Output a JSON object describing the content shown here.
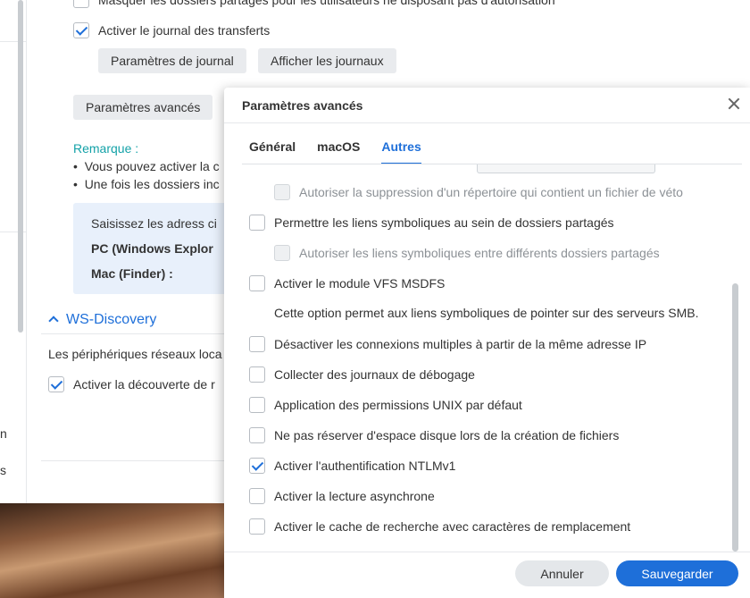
{
  "background": {
    "left_fragments": [
      "n",
      "s"
    ],
    "hide_shared_folders_label": "Masquer les dossiers partagés pour les utilisateurs ne disposant pas d'autorisation",
    "enable_transfer_log_label": "Activer le journal des transferts",
    "log_settings_button": "Paramètres de journal",
    "show_logs_button": "Afficher les journaux",
    "advanced_settings_button": "Paramètres avancés",
    "note_title": "Remarque :",
    "note_bullets": [
      "Vous pouvez activer la c",
      "Une fois les dossiers inc"
    ],
    "info_box": {
      "line1": "Saisissez les adress ci",
      "pc_label": "PC (Windows Explor",
      "mac_label": "Mac (Finder) :"
    },
    "ws_discovery": {
      "title": "WS-Discovery",
      "description": "Les périphériques réseaux loca",
      "enable_label": "Activer la découverte de r"
    }
  },
  "dialog": {
    "title": "Paramètres avancés",
    "tabs": [
      {
        "label": "Général",
        "active": false
      },
      {
        "label": "macOS",
        "active": false
      },
      {
        "label": "Autres",
        "active": true
      }
    ],
    "options": [
      {
        "label": "Autoriser la suppression d'un répertoire qui contient un fichier de véto",
        "checked": false,
        "disabled": true
      },
      {
        "label": "Permettre les liens symboliques au sein de dossiers partagés",
        "checked": false,
        "disabled": false
      },
      {
        "label": "Autoriser les liens symboliques entre différents dossiers partagés",
        "checked": false,
        "disabled": true
      },
      {
        "label": "Activer le module VFS MSDFS",
        "checked": false,
        "disabled": false
      },
      {
        "label": "Désactiver les connexions multiples à partir de la même adresse IP",
        "checked": false,
        "disabled": false
      },
      {
        "label": "Collecter des journaux de débogage",
        "checked": false,
        "disabled": false
      },
      {
        "label": "Application des permissions UNIX par défaut",
        "checked": false,
        "disabled": false
      },
      {
        "label": "Ne pas réserver d'espace disque lors de la création de fichiers",
        "checked": false,
        "disabled": false
      },
      {
        "label": "Activer l'authentification NTLMv1",
        "checked": true,
        "disabled": false
      },
      {
        "label": "Activer la lecture asynchrone",
        "checked": false,
        "disabled": false
      },
      {
        "label": "Activer le cache de recherche avec caractères de remplacement",
        "checked": false,
        "disabled": false
      }
    ],
    "msdfs_description": "Cette option permet aux liens symboliques de pointer sur des serveurs SMB.",
    "cancel_button": "Annuler",
    "save_button": "Sauvegarder"
  },
  "colors": {
    "accent": "#1e6fd9",
    "note": "#14a2a8"
  }
}
